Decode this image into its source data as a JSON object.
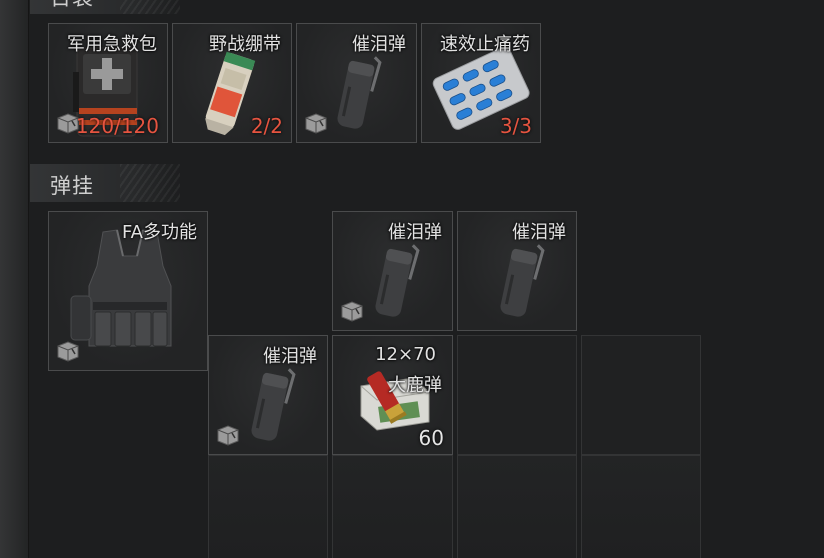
{
  "sections": {
    "bag": {
      "title": "日袋"
    },
    "rig": {
      "title": "弹挂"
    }
  },
  "bag_items": [
    {
      "name": "军用急救包",
      "count": "120/120",
      "icon": "first-aid-kit"
    },
    {
      "name": "野战绷带",
      "count": "2/2",
      "icon": "bandage"
    },
    {
      "name": "催泪弹",
      "count": "",
      "icon": "tear-gas-grenade"
    },
    {
      "name": "速效止痛药",
      "count": "3/3",
      "icon": "painkiller-pills"
    }
  ],
  "rig_items": [
    {
      "name": "FA多功能",
      "count": "",
      "icon": "tactical-vest"
    },
    {
      "name": "催泪弹",
      "count": "",
      "icon": "tear-gas-grenade"
    },
    {
      "name": "催泪弹",
      "count": "",
      "icon": "tear-gas-grenade"
    },
    {
      "name": "催泪弹",
      "count": "",
      "icon": "tear-gas-grenade"
    },
    {
      "name_line1": "12×70",
      "name_line2": "大鹿弹",
      "count": "60",
      "icon": "shotgun-shells"
    }
  ],
  "colors": {
    "count_red": "#e65440",
    "slot_border": "#4a4b4c",
    "background": "#1d1e1f"
  }
}
